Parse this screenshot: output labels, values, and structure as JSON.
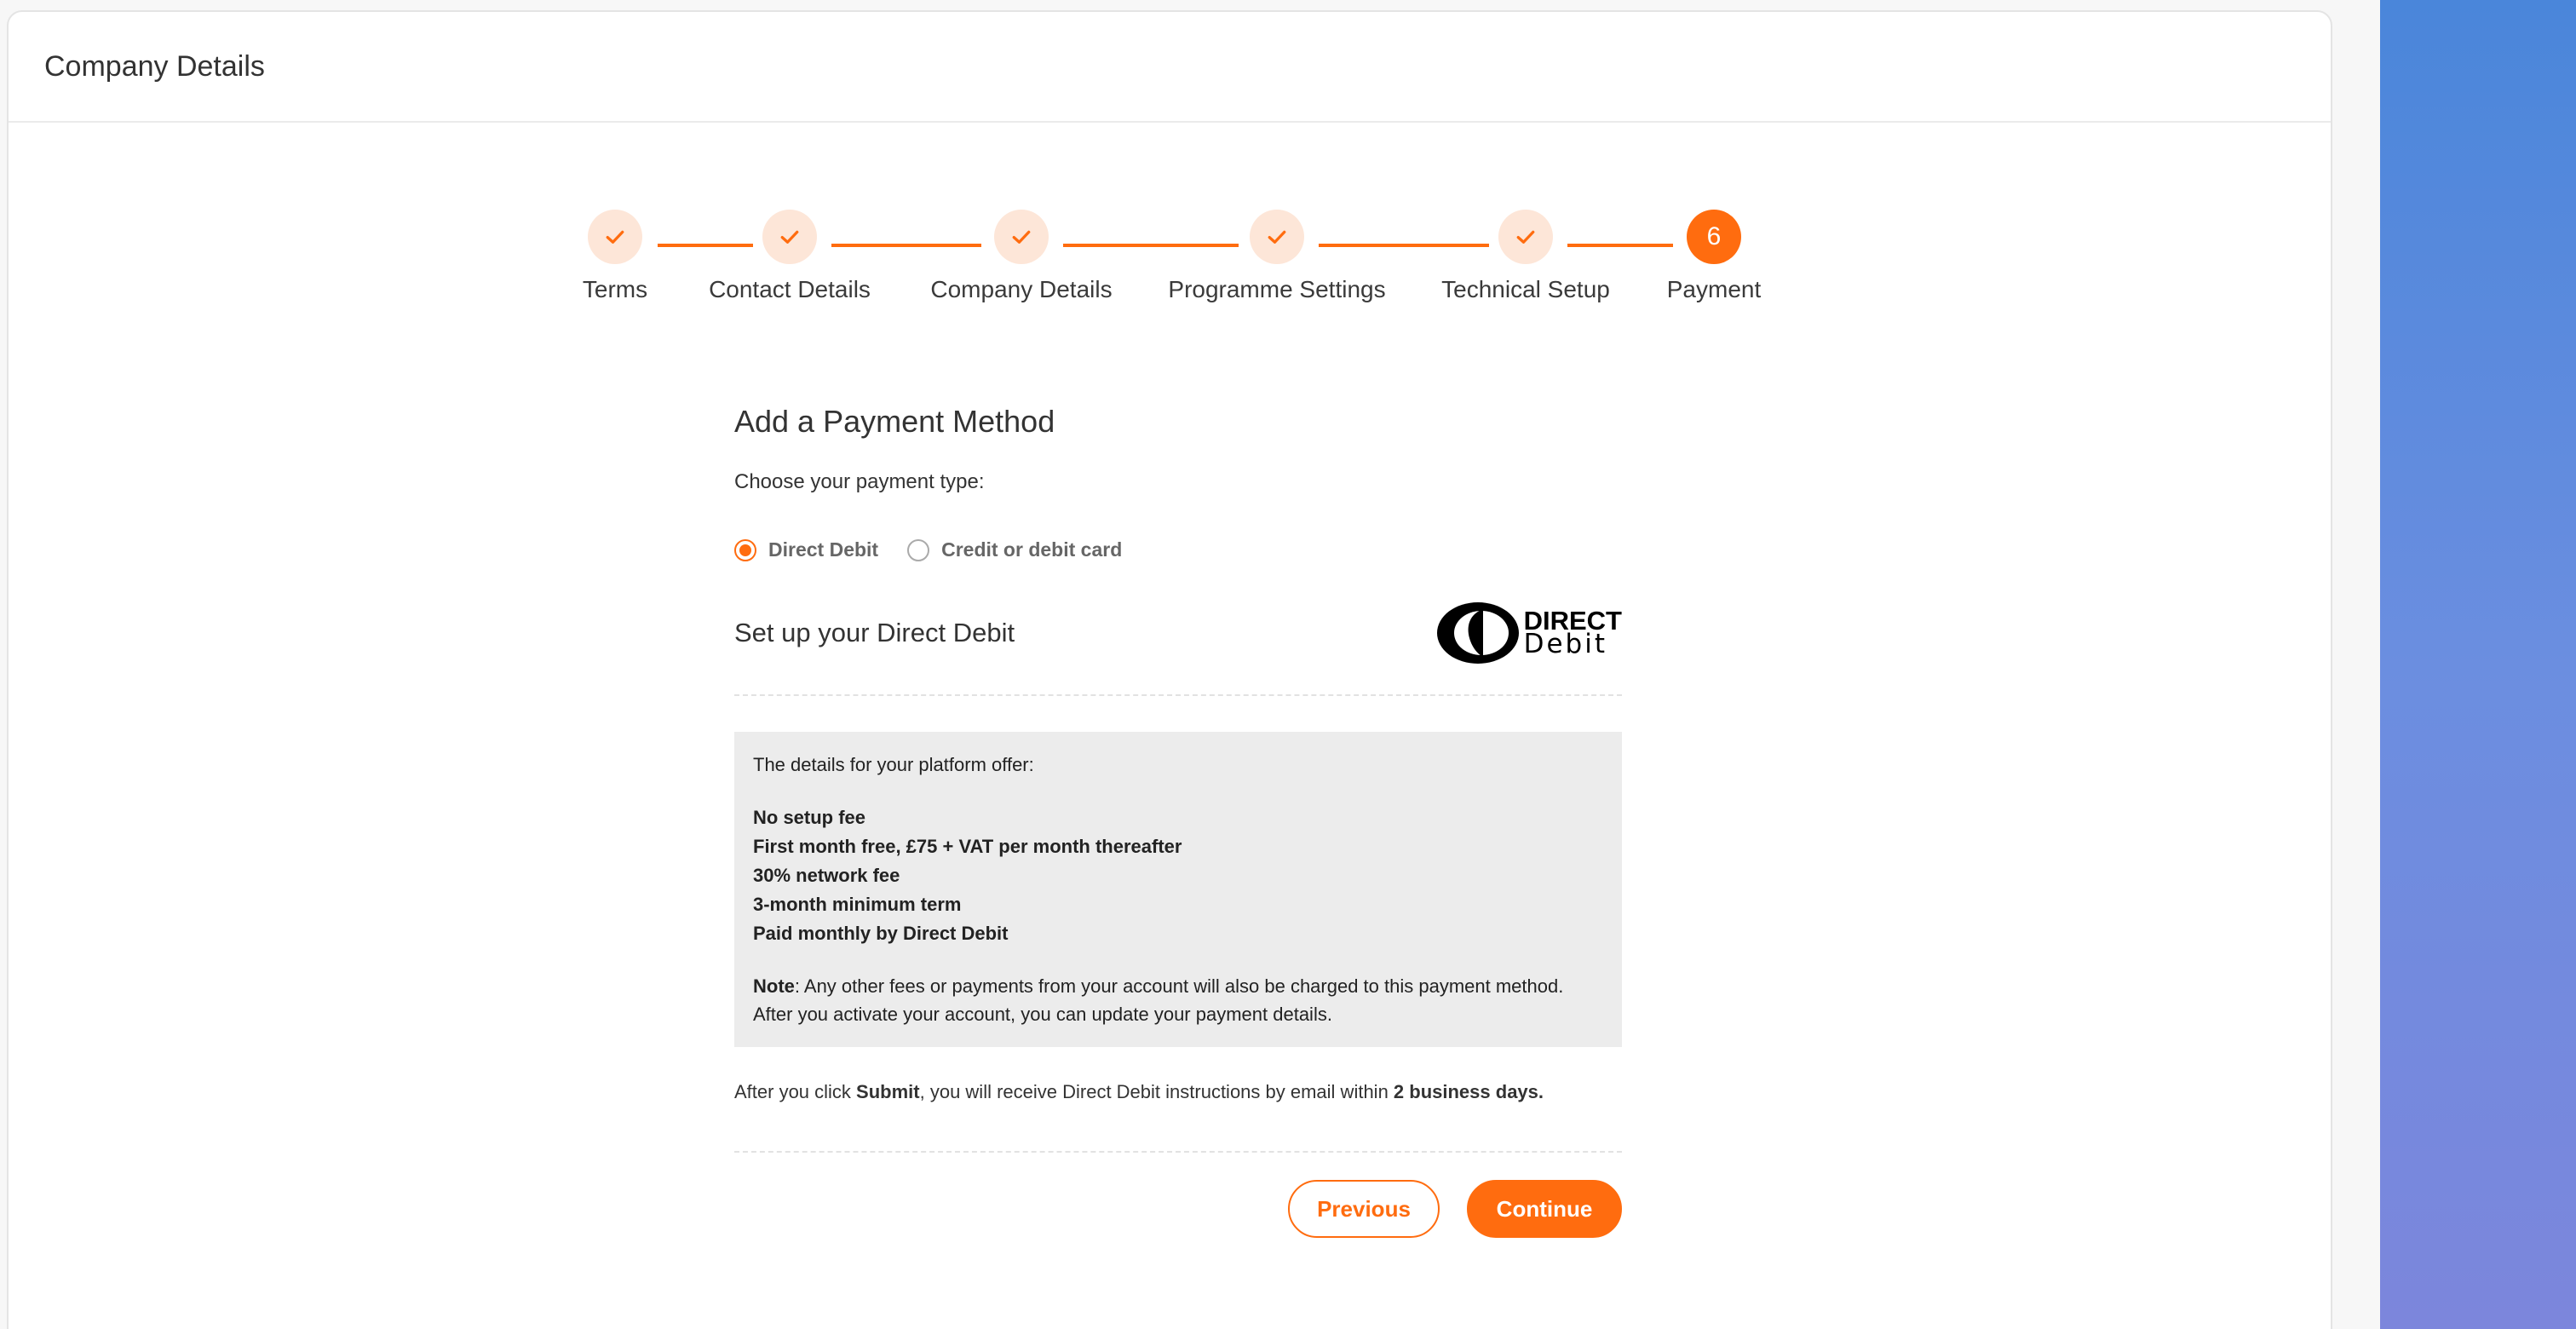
{
  "header": {
    "title": "Company Details"
  },
  "stepper": {
    "steps": [
      {
        "label": "Terms",
        "status": "complete"
      },
      {
        "label": "Contact Details",
        "status": "complete"
      },
      {
        "label": "Company Details",
        "status": "complete"
      },
      {
        "label": "Programme Settings",
        "status": "complete"
      },
      {
        "label": "Technical Setup",
        "status": "complete"
      },
      {
        "label": "Payment",
        "status": "active",
        "number": "6"
      }
    ],
    "accent_color": "#ff6c0f",
    "complete_bg_color": "#fde6d8"
  },
  "payment": {
    "heading": "Add a Payment Method",
    "choose_label": "Choose your payment type:",
    "options": [
      {
        "label": "Direct Debit",
        "selected": true
      },
      {
        "label": "Credit or debit card",
        "selected": false
      }
    ],
    "setup_title": "Set up your Direct Debit",
    "logo": {
      "line1": "DIRECT",
      "line2": "Debit"
    },
    "offer": {
      "intro": "The details for your platform offer:",
      "items": [
        "No setup fee",
        "First month free, £75 + VAT per month thereafter",
        "30% network fee",
        "3-month minimum term",
        "Paid monthly by Direct Debit"
      ],
      "note_label": "Note",
      "note_text": ": Any other fees or payments from your account will also be charged to this payment method. After you activate your account, you can update your payment details."
    },
    "after": {
      "part1": "After you click ",
      "submit": "Submit",
      "part2": ", you will receive Direct Debit instructions by email within ",
      "days": "2 business days."
    }
  },
  "buttons": {
    "previous": "Previous",
    "continue": "Continue"
  }
}
